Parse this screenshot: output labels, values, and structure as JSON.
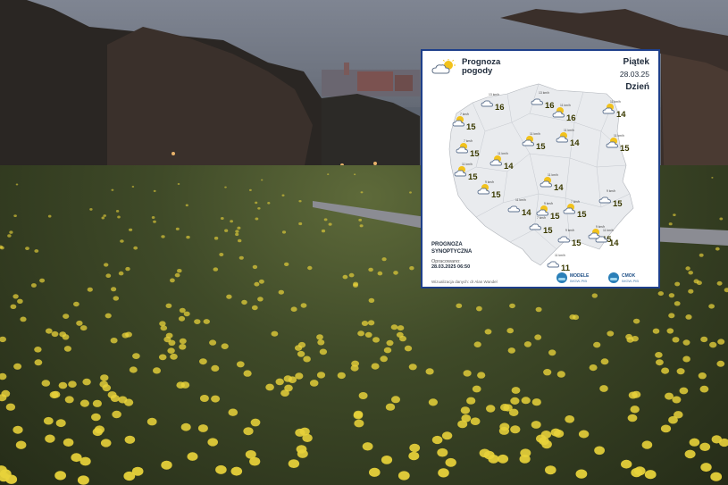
{
  "forecast": {
    "title": "Prognoza\npogody",
    "day_name": "Piątek",
    "date": "28.03.25",
    "period": "Dzień",
    "synoptic_label": "PROGNOZA\nSYNOPTYCZNA",
    "prepared_label": "Opracowano:",
    "prepared_time": "28.03.2025 06:50",
    "visualization": "Wizualizacja danych: dr Alan Wandel",
    "logos": [
      {
        "name": "MODELE",
        "sub": "IMGW-PIB"
      },
      {
        "name": "CMOK",
        "sub": "IMGW-PIB"
      }
    ],
    "stations": [
      {
        "temp": "16",
        "wind": "13 km/h",
        "icon": "cloud"
      },
      {
        "temp": "16",
        "wind": "13 km/h",
        "icon": "cloud"
      },
      {
        "temp": "16",
        "wind": "11 km/h",
        "icon": "sun-cloud"
      },
      {
        "temp": "14",
        "wind": "11 km/h",
        "icon": "sun-cloud"
      },
      {
        "temp": "15",
        "wind": "7 km/h",
        "icon": "sun-cloud"
      },
      {
        "temp": "15",
        "wind": "11 km/h",
        "icon": "sun-cloud"
      },
      {
        "temp": "14",
        "wind": "11 km/h",
        "icon": "sun-cloud"
      },
      {
        "temp": "15",
        "wind": "11 km/h",
        "icon": "sun-cloud"
      },
      {
        "temp": "15",
        "wind": "7 km/h",
        "icon": "sun-cloud"
      },
      {
        "temp": "14",
        "wind": "11 km/h",
        "icon": "sun-cloud"
      },
      {
        "temp": "15",
        "wind": "11 km/h",
        "icon": "sun-cloud"
      },
      {
        "temp": "14",
        "wind": "11 km/h",
        "icon": "sun-cloud"
      },
      {
        "temp": "15",
        "wind": "9 km/h",
        "icon": "sun-cloud"
      },
      {
        "temp": "15",
        "wind": "9 km/h",
        "icon": "sun-cloud"
      },
      {
        "temp": "15",
        "wind": "7 km/h",
        "icon": "sun-cloud"
      },
      {
        "temp": "15",
        "wind": "9 km/h",
        "icon": "cloud"
      },
      {
        "temp": "14",
        "wind": "11 km/h",
        "icon": "cloud"
      },
      {
        "temp": "15",
        "wind": "9 km/h",
        "icon": "sun-cloud"
      },
      {
        "temp": "15",
        "wind": "7 km/h",
        "icon": "cloud"
      },
      {
        "temp": "15",
        "wind": "9 km/h",
        "icon": "cloud"
      },
      {
        "temp": "14",
        "wind": "11 km/h",
        "icon": "cloud"
      },
      {
        "temp": "11",
        "wind": "11 km/h",
        "icon": "cloud"
      }
    ]
  },
  "colors": {
    "card_border": "#1e3f8a",
    "map_fill": "#e9ebee",
    "sun": "#f2c21b",
    "cloud": "#6d8db5",
    "daffodil": "#e8d23a"
  }
}
